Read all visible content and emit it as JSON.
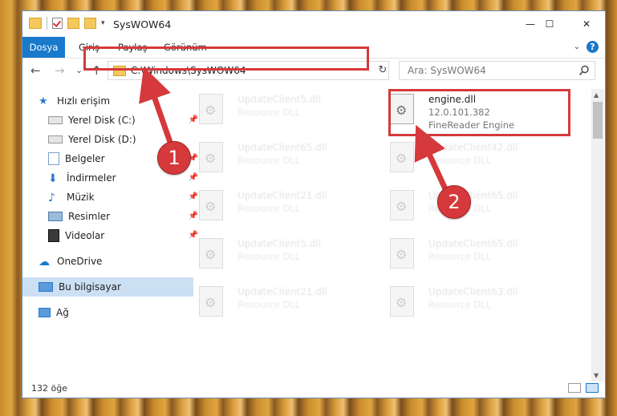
{
  "window": {
    "title": "SysWOW64",
    "controls": {
      "minimize": "—",
      "maximize": "☐",
      "close": "✕"
    }
  },
  "ribbon": {
    "tabs": [
      "Dosya",
      "Giriş",
      "Paylaş",
      "Görünüm"
    ],
    "help": "?"
  },
  "navigation": {
    "back": "←",
    "forward": "→",
    "recent": "⌄",
    "up": "↑",
    "address": "C:\\Windows\\SysWOW64",
    "refresh": "↻",
    "search_placeholder": "Ara: SysWOW64"
  },
  "sidebar": {
    "items": [
      {
        "label": "Hızlı erişim",
        "icon": "star-icon"
      },
      {
        "label": "Yerel Disk (C:)",
        "icon": "drive-icon"
      },
      {
        "label": "Yerel Disk (D:)",
        "icon": "drive-icon"
      },
      {
        "label": "Belgeler",
        "icon": "documents-icon"
      },
      {
        "label": "İndirmeler",
        "icon": "download-icon"
      },
      {
        "label": "Müzik",
        "icon": "music-icon"
      },
      {
        "label": "Resimler",
        "icon": "pictures-icon"
      },
      {
        "label": "Videolar",
        "icon": "videos-icon"
      },
      {
        "label": "OneDrive",
        "icon": "cloud-icon"
      },
      {
        "label": "Bu bilgisayar",
        "icon": "computer-icon"
      },
      {
        "label": "Ağ",
        "icon": "network-icon"
      }
    ]
  },
  "files": {
    "target": {
      "name": "engine.dll",
      "version": "12.0.101.382",
      "description": "FineReader Engine"
    },
    "left": [
      {
        "name": "UpdateClient5.dll",
        "desc": "Resource DLL"
      },
      {
        "name": "UpdateClient65.dll",
        "desc": "Resource DLL"
      },
      {
        "name": "UpdateClient21.dll",
        "desc": "Resource DLL"
      },
      {
        "name": "UpdateClient5.dll",
        "desc": "Resource DLL"
      },
      {
        "name": "UpdateClient21.dll",
        "desc": "Resource DLL"
      }
    ],
    "right": [
      {
        "name": "UpdateClient42.dll",
        "desc": "Resource DLL"
      },
      {
        "name": "UpdateClient65.dll",
        "desc": "Resource DLL"
      },
      {
        "name": "UpdateClient65.dll",
        "desc": "Resource DLL"
      },
      {
        "name": "UpdateClient63.dll",
        "desc": "Resource DLL"
      }
    ]
  },
  "status": {
    "count": "132 öğe"
  },
  "callouts": [
    "1",
    "2"
  ],
  "colors": {
    "accent": "#1979ca",
    "highlight": "#d5393b",
    "selection": "#cce0f4"
  }
}
